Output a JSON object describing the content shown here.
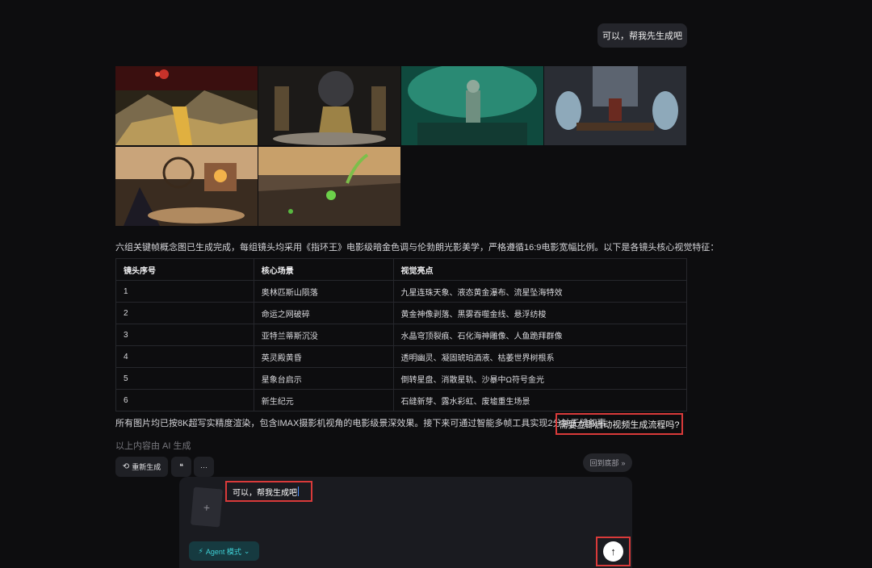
{
  "user_message": "可以，帮我先生成吧",
  "images": [
    {
      "alt_icon": "olympus-falls-image"
    },
    {
      "alt_icon": "web-of-fate-image"
    },
    {
      "alt_icon": "atlantis-image"
    },
    {
      "alt_icon": "valhalla-image"
    },
    {
      "alt_icon": "astrology-platform-image"
    },
    {
      "alt_icon": "new-era-image"
    }
  ],
  "summary": "六组关键帧概念图已生成完成，每组镜头均采用《指环王》电影级暗金色调与伦勃朗光影美学，严格遵循16:9电影宽幅比例。以下是各镜头核心视觉特征：",
  "table": {
    "headers": [
      "镜头序号",
      "核心场景",
      "视觉亮点"
    ],
    "rows": [
      [
        "1",
        "奥林匹斯山陨落",
        "九星连珠天象、液态黄金瀑布、流星坠海特效"
      ],
      [
        "2",
        "命运之网破碎",
        "黄金神像剥落、黑雾吞噬金线、悬浮纺梭"
      ],
      [
        "3",
        "亚特兰蒂斯沉没",
        "水晶穹顶裂痕、石化海神雕像、人鱼跪拜群像"
      ],
      [
        "4",
        "英灵殿黄昏",
        "透明幽灵、凝固琥珀酒液、枯萎世界树根系"
      ],
      [
        "5",
        "星象台启示",
        "倒转星盘、消散星轨、沙暴中Ω符号金光"
      ],
      [
        "6",
        "新生纪元",
        "石缝新芽、露水彩虹、废墟重生场景"
      ]
    ]
  },
  "conclusion": "所有图片均已按8K超写实精度渲染，包含IMAX摄影机视角的电影级景深效果。接下来可通过智能多帧工具实现2分钟无缝叙事",
  "conclusion_question": "需要立即启动视频生成流程吗?",
  "ai_note": "以上内容由 AI 生成",
  "actions": {
    "regenerate": "重新生成",
    "quote": "❝",
    "more": "···"
  },
  "back_to_bottom": "回到底部",
  "composer": {
    "input_value": "可以，帮我生成吧",
    "attach_icon": "+",
    "agent_mode": "Agent 模式"
  },
  "colors": {
    "highlight_border": "#d93a3a",
    "agent_accent": "#3fd1d6"
  }
}
